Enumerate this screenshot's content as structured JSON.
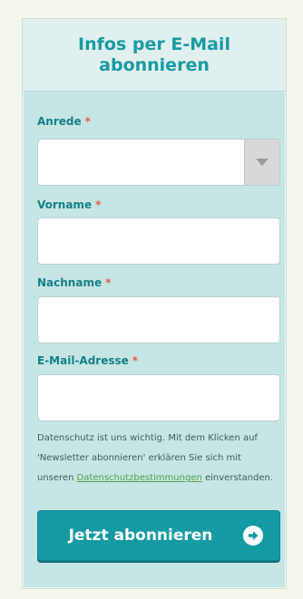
{
  "header": {
    "title": "Infos per E-Mail abonnieren"
  },
  "form": {
    "required_marker": "*",
    "salutation": {
      "label": "Anrede",
      "value": ""
    },
    "first_name": {
      "label": "Vorname",
      "value": ""
    },
    "last_name": {
      "label": "Nachname",
      "value": ""
    },
    "email": {
      "label": "E-Mail-Adresse",
      "value": ""
    },
    "privacy": {
      "text_before": "Datenschutz ist uns wichtig. Mit dem Klicken auf 'Newsletter abonnieren' erklären Sie sich mit unseren ",
      "link_text": "Datenschutzbestimmungen",
      "text_after": " einverstanden."
    },
    "submit": {
      "label": "Jetzt abonnieren",
      "icon": "arrow-right-circle-icon"
    }
  },
  "colors": {
    "panel_bg": "#c5e6e4",
    "header_bg": "#dff0ee",
    "title": "#1a9aa2",
    "label": "#167f86",
    "required": "#e45b52",
    "link": "#4fa24c",
    "button_bg": "#149aa3"
  }
}
